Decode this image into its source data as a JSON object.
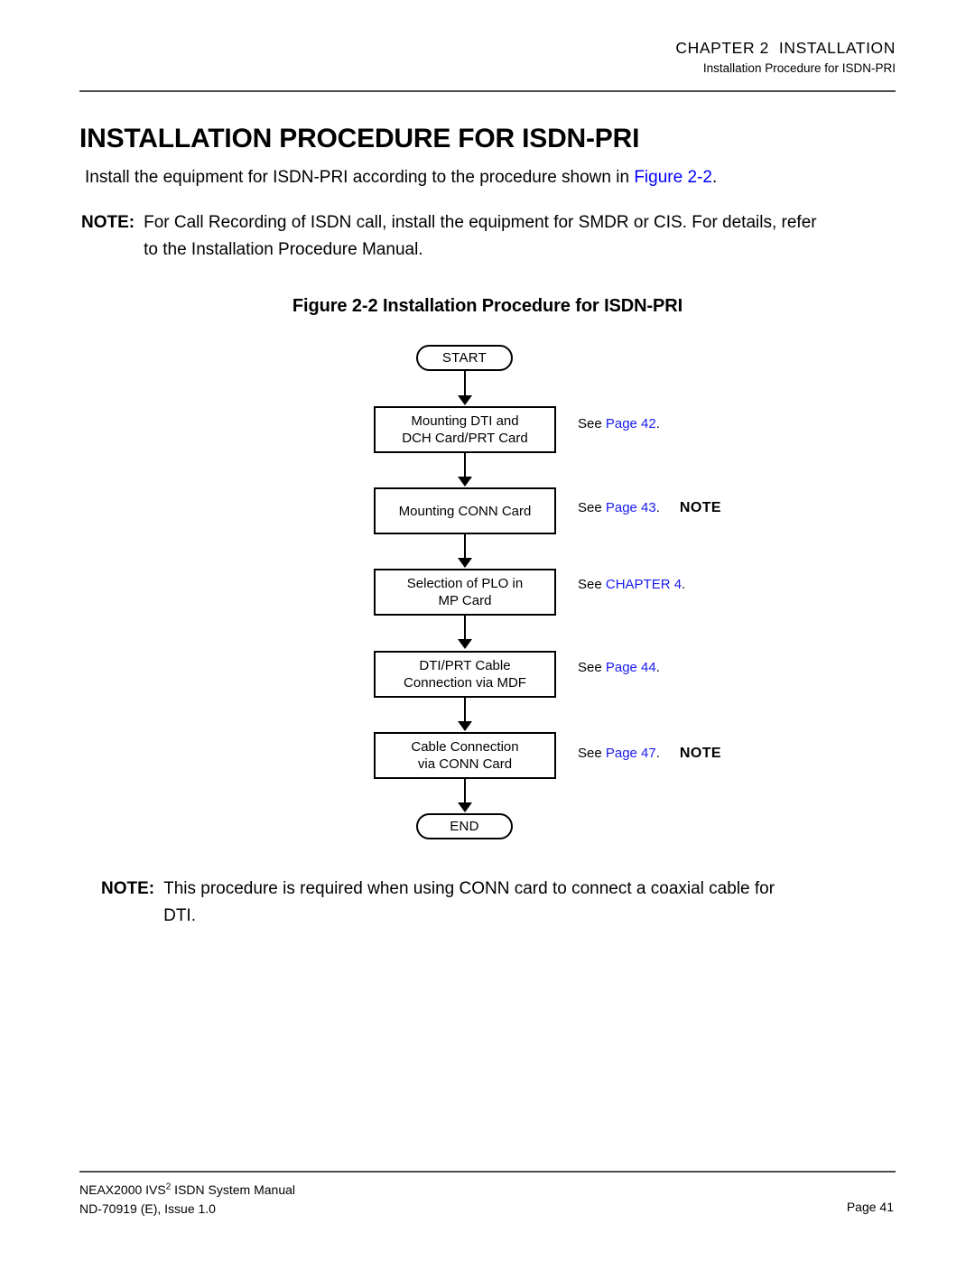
{
  "header": {
    "chapter": "CHAPTER 2  INSTALLATION",
    "subtitle": "Installation Procedure for ISDN-PRI"
  },
  "title": "INSTALLATION PROCEDURE FOR ISDN-PRI",
  "intro": {
    "before_link": "Install the equipment for ISDN-PRI according to the procedure shown in ",
    "link": "Figure 2-2",
    "after_link": "."
  },
  "note_top": {
    "label": "NOTE:",
    "line1": "For Call Recording of ISDN call, install the equipment for SMDR or CIS. For details, refer",
    "line2": "to the Installation Procedure Manual."
  },
  "figure": {
    "caption": "Figure 2-2  Installation Procedure for ISDN-PRI",
    "start_label": "START",
    "end_label": "END",
    "steps": [
      {
        "box_text": "Mounting DTI and\nDCH Card/PRT Card",
        "see_prefix": "See ",
        "see_link": "Page 42",
        "see_suffix": ".",
        "tag": ""
      },
      {
        "box_text": "Mounting CONN Card",
        "see_prefix": "See ",
        "see_link": "Page 43",
        "see_suffix": ".",
        "tag": "NOTE"
      },
      {
        "box_text": "Selection of PLO in\nMP Card",
        "see_prefix": "See ",
        "see_link": "CHAPTER 4",
        "see_suffix": ".",
        "tag": ""
      },
      {
        "box_text": "DTI/PRT Cable\nConnection via MDF",
        "see_prefix": "See ",
        "see_link": "Page 44",
        "see_suffix": ".",
        "tag": ""
      },
      {
        "box_text": "Cable Connection\nvia CONN Card",
        "see_prefix": "See ",
        "see_link": "Page 47",
        "see_suffix": ".",
        "tag": "NOTE"
      }
    ]
  },
  "note_bottom": {
    "label": "NOTE:",
    "line1": "This procedure is required when using CONN card to connect a coaxial cable for",
    "line2": "DTI."
  },
  "footer": {
    "manual_pre": "NEAX2000 IVS",
    "manual_sup": "2",
    "manual_post": " ISDN System Manual",
    "doc_id": "ND-70919 (E), Issue 1.0",
    "page": "Page 41"
  },
  "colors": {
    "link": "#0000ff",
    "link_soft": "#1a1aee",
    "rule": "#4d4d4d",
    "text": "#000000"
  }
}
